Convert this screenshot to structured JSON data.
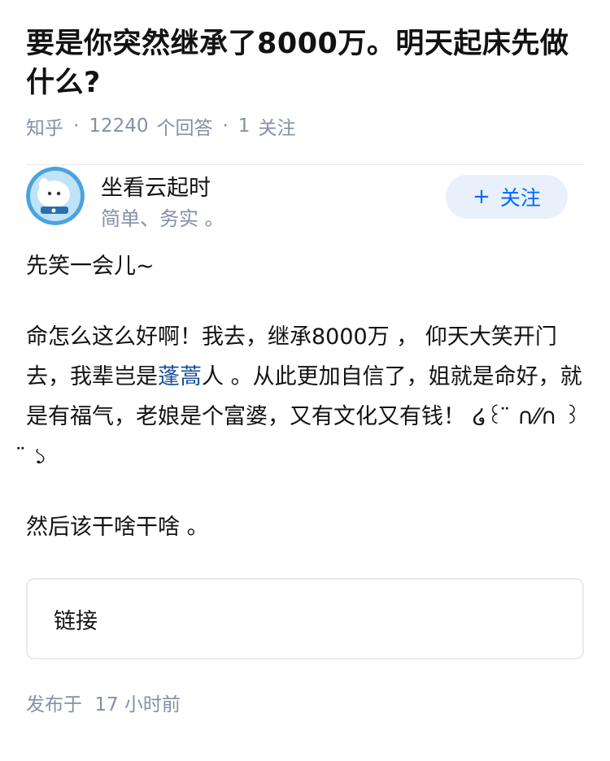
{
  "question": {
    "title": "要是你突然继承了8000万。明天起床先做什么?",
    "source": "知乎",
    "answers_count": "12240",
    "answers_label": "个回答",
    "follow_count": "1",
    "follow_label": "关注"
  },
  "author": {
    "name": "坐看云起时",
    "bio": "简单、务实 。",
    "follow_button": "关注"
  },
  "answer": {
    "p1": "先笑一会儿~",
    "p2_before": "命怎么这么好啊！我去，继承8000万 ， 仰天大笑开门去，我辈岂是",
    "p2_keyword": "蓬蒿",
    "p2_after": "人 。从此更加自信了，姐就是命好，就是有福气，老娘是个富婆，又有文化又有钱！ ໒꒰ ̈ ∩⁄⁄∩ ꒱ ̈ ১",
    "p3": "然后该干啥干啥 。"
  },
  "link_card": {
    "label": "链接"
  },
  "footer": {
    "published_label": "发布于",
    "published_time": "17 小时前"
  },
  "colors": {
    "accent": "#0066ff",
    "meta": "#8590a6",
    "keyword": "#175199"
  }
}
